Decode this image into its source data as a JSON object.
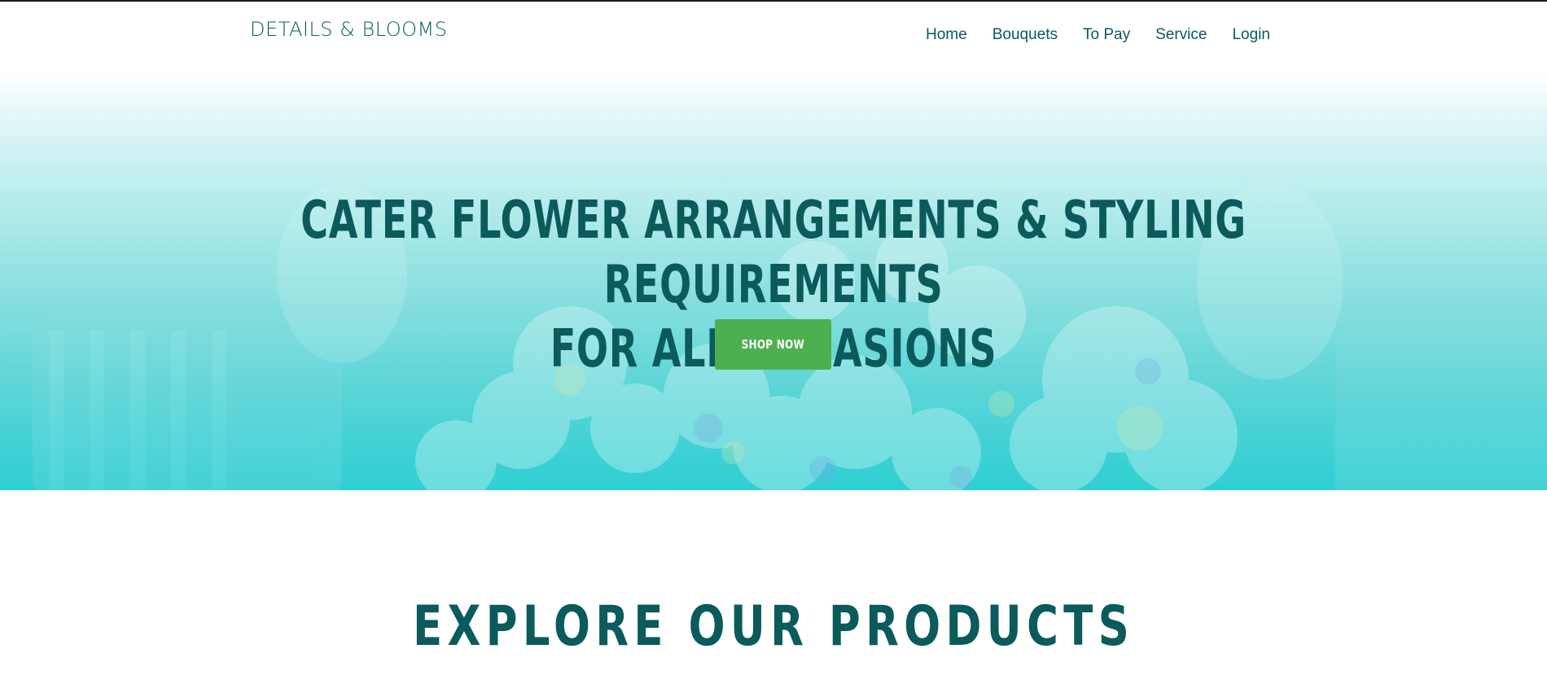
{
  "header": {
    "brand": "DETAILS & BLOOMS",
    "nav": [
      {
        "label": "Home"
      },
      {
        "label": "Bouquets"
      },
      {
        "label": "To Pay"
      },
      {
        "label": "Service"
      },
      {
        "label": "Login"
      }
    ]
  },
  "hero": {
    "headline_line1": "CATER FLOWER ARRANGEMENTS & STYLING REQUIREMENTS",
    "headline_line2": "FOR ALL OCCASIONS",
    "cta_label": "SHOP NOW",
    "background_image": "bride-bouquet-photo"
  },
  "products_section": {
    "title": "EXPLORE OUR PRODUCTS"
  },
  "colors": {
    "brand_teal": "#0b5a5c",
    "cta_green": "#4caf50",
    "hero_gradient_bottom": "#2ecfd3"
  }
}
